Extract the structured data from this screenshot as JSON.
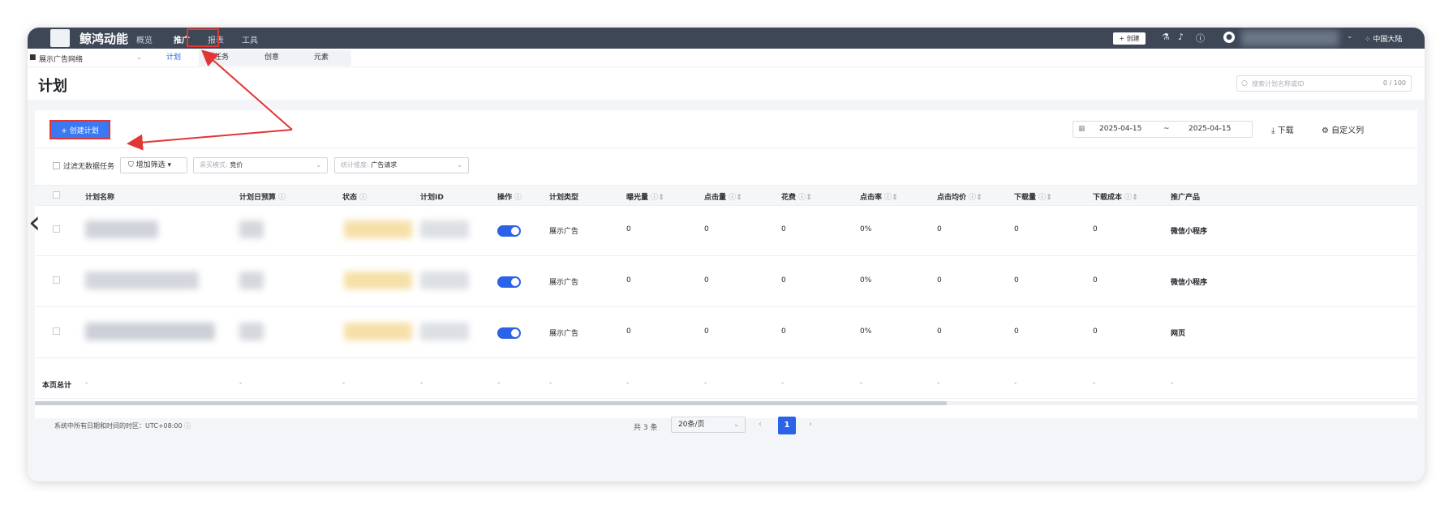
{
  "header": {
    "brand": "鲸鸿动能",
    "nav": [
      "概览",
      "推广",
      "报表",
      "工具"
    ],
    "active_nav": "推广",
    "create_label": "+ 创建",
    "region": "⁘ 中国大陆"
  },
  "subnav": {
    "network": "展示广告网络",
    "tabs": [
      "计划",
      "任务",
      "创意",
      "元素"
    ],
    "active_tab": "计划"
  },
  "page": {
    "title": "计划",
    "search_placeholder": "搜索计划名称或ID",
    "search_count": "0 / 100"
  },
  "toolbar": {
    "create_plan": "+ 创建计划",
    "date_start": "2025-04-15",
    "date_sep": "~",
    "date_end": "2025-04-15",
    "download": "下载",
    "custom_columns": "自定义列"
  },
  "filters": {
    "hide_no_data": "过滤无数据任务",
    "add_filter": "增加筛选",
    "buy_mode_label": "采买模式:",
    "buy_mode_value": "竞价",
    "stat_dim_label": "统计维度:",
    "stat_dim_value": "广告请求"
  },
  "table": {
    "columns": [
      "计划名称",
      "计划日预算",
      "状态",
      "计划ID",
      "操作",
      "计划类型",
      "曝光量",
      "点击量",
      "花费",
      "点击率",
      "点击均价",
      "下载量",
      "下载成本",
      "推广产品"
    ],
    "rows": [
      {
        "type": "展示广告",
        "impressions": "0",
        "clicks": "0",
        "cost": "0",
        "ctr": "0%",
        "cpc": "0",
        "downloads": "0",
        "dl_cost": "0",
        "product": "微信小程序"
      },
      {
        "type": "展示广告",
        "impressions": "0",
        "clicks": "0",
        "cost": "0",
        "ctr": "0%",
        "cpc": "0",
        "downloads": "0",
        "dl_cost": "0",
        "product": "微信小程序"
      },
      {
        "type": "展示广告",
        "impressions": "0",
        "clicks": "0",
        "cost": "0",
        "ctr": "0%",
        "cpc": "0",
        "downloads": "0",
        "dl_cost": "0",
        "product": "网页"
      }
    ],
    "total_label": "本页总计",
    "total_placeholder": "-"
  },
  "footer": {
    "timezone": "系统中所有日期和时间的时区：UTC+08:00",
    "total": "共 3 条",
    "page_size": "20条/页",
    "current_page": "1"
  },
  "colors": {
    "topbar": "#3d4756",
    "primary": "#2a62e8",
    "highlight": "#e23535"
  }
}
